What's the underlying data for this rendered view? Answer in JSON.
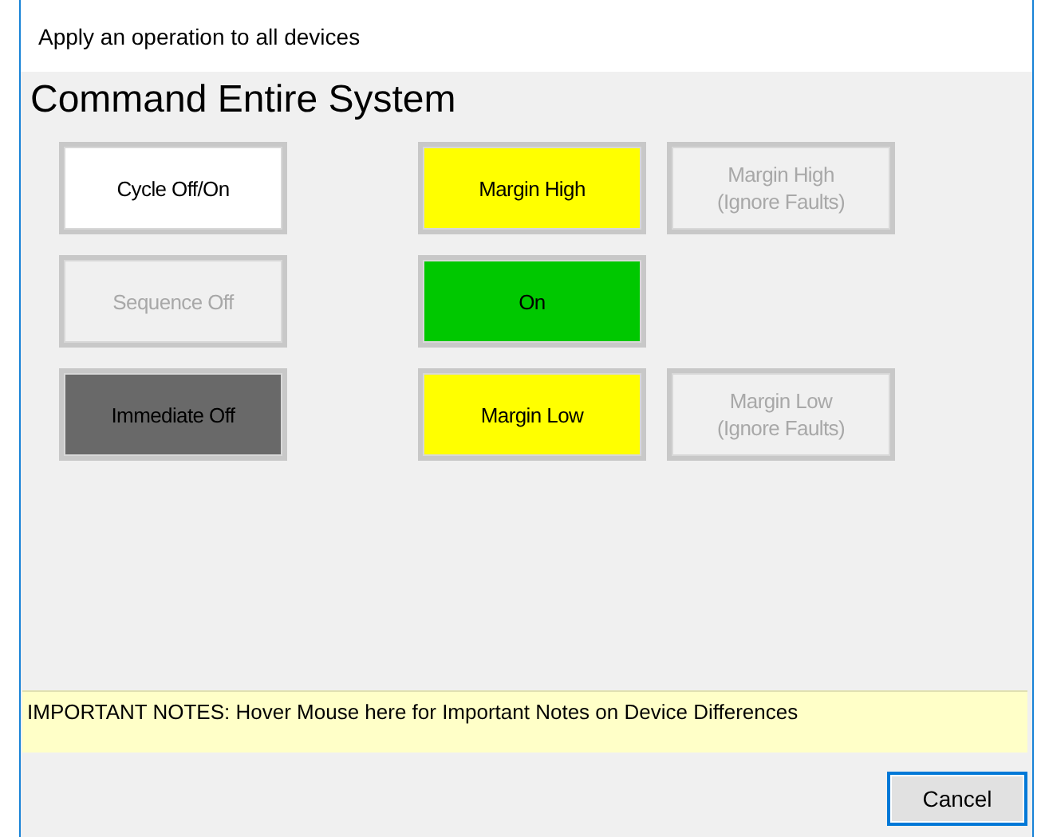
{
  "window": {
    "title": "Apply an operation to all devices"
  },
  "heading": "Command Entire System",
  "rows": [
    {
      "left": {
        "label": "Cycle Off/On",
        "disabled": false,
        "color": "#ffffff"
      },
      "middle": {
        "label": "Margin High",
        "disabled": false,
        "color": "#ffff00"
      },
      "right": {
        "label": "Margin High\n(Ignore Faults)",
        "disabled": true,
        "color": "#f0f0f0"
      }
    },
    {
      "left": {
        "label": "Sequence Off",
        "disabled": true,
        "color": "#f0f0f0"
      },
      "middle": {
        "label": "On",
        "disabled": false,
        "color": "#00c800"
      }
    },
    {
      "left": {
        "label": "Immediate Off",
        "disabled": false,
        "color": "#696969"
      },
      "middle": {
        "label": "Margin Low",
        "disabled": false,
        "color": "#ffff00"
      },
      "right": {
        "label": "Margin Low\n(Ignore Faults)",
        "disabled": true,
        "color": "#f0f0f0"
      }
    }
  ],
  "notes": "IMPORTANT NOTES: Hover Mouse here for Important Notes on Device Differences",
  "buttons": [
    "Cancel"
  ]
}
